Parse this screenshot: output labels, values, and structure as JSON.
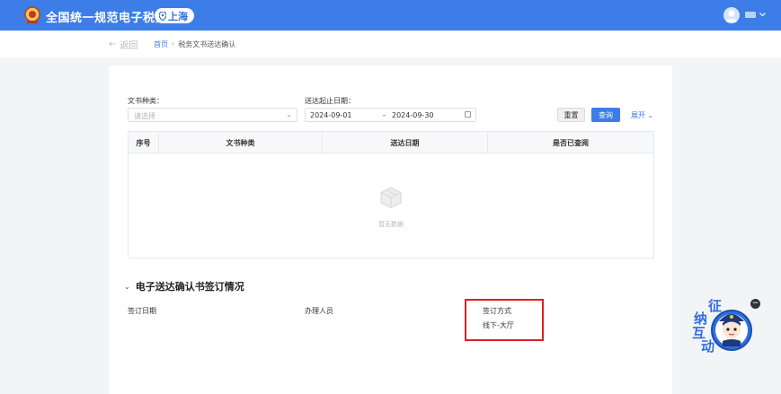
{
  "header": {
    "app_title": "全国统一规范电子税务局",
    "region": "上海"
  },
  "nav": {
    "back_label": "返回",
    "breadcrumb": [
      "首页",
      "税务文书送达确认"
    ]
  },
  "filters": {
    "doc_type_label": "文书种类：",
    "doc_type_placeholder": "请选择",
    "date_range_label": "送达起止日期：",
    "date_start": "2024-09-01",
    "date_sep": "-",
    "date_end": "2024-09-30",
    "reset_label": "重置",
    "query_label": "查询",
    "expand_label": "展开"
  },
  "table": {
    "columns": [
      "序号",
      "文书种类",
      "送达日期",
      "是否已查阅"
    ],
    "rows": [],
    "empty_text": "暂无数据"
  },
  "signing": {
    "title": "电子送达确认书签订情况",
    "fields": [
      {
        "label": "签订日期",
        "value": ""
      },
      {
        "label": "办理人员",
        "value": ""
      },
      {
        "label": "签订方式",
        "value": "线下-大厅"
      }
    ]
  },
  "helper": {
    "text": [
      "征",
      "纳",
      "互",
      "动"
    ]
  },
  "colors": {
    "primary": "#3c7de8",
    "highlight": "#e02020"
  }
}
